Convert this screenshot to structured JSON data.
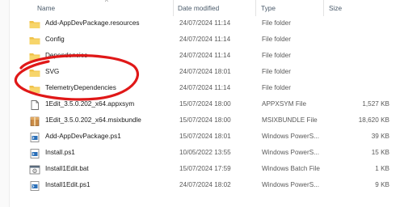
{
  "columns": {
    "name": "Name",
    "date": "Date modified",
    "type": "Type",
    "size": "Size"
  },
  "sort_indicator": "^",
  "files": [
    {
      "name": "Add-AppDevPackage.resources",
      "date": "24/07/2024 11:14",
      "type": "File folder",
      "size": "",
      "icon": "folder-icon"
    },
    {
      "name": "Config",
      "date": "24/07/2024 11:14",
      "type": "File folder",
      "size": "",
      "icon": "folder-icon"
    },
    {
      "name": "Dependencies",
      "date": "24/07/2024 11:14",
      "type": "File folder",
      "size": "",
      "icon": "folder-icon"
    },
    {
      "name": "SVG",
      "date": "24/07/2024 18:01",
      "type": "File folder",
      "size": "",
      "icon": "folder-icon"
    },
    {
      "name": "TelemetryDependencies",
      "date": "24/07/2024 11:14",
      "type": "File folder",
      "size": "",
      "icon": "folder-icon"
    },
    {
      "name": "1Edit_3.5.0.202_x64.appxsym",
      "date": "15/07/2024 18:00",
      "type": "APPXSYM File",
      "size": "1,527 KB",
      "icon": "blank-file-icon"
    },
    {
      "name": "1Edit_3.5.0.202_x64.msixbundle",
      "date": "15/07/2024 18:00",
      "type": "MSIXBUNDLE File",
      "size": "18,620 KB",
      "icon": "package-icon"
    },
    {
      "name": "Add-AppDevPackage.ps1",
      "date": "15/07/2024 18:01",
      "type": "Windows PowerS...",
      "size": "39 KB",
      "icon": "script-icon"
    },
    {
      "name": "Install.ps1",
      "date": "10/05/2022 13:55",
      "type": "Windows PowerS...",
      "size": "15 KB",
      "icon": "script-icon"
    },
    {
      "name": "Install1Edit.bat",
      "date": "15/07/2024 17:59",
      "type": "Windows Batch File",
      "size": "1 KB",
      "icon": "batch-file-icon"
    },
    {
      "name": "Install1Edit.ps1",
      "date": "24/07/2024 18:02",
      "type": "Windows PowerS...",
      "size": "9 KB",
      "icon": "script-icon"
    }
  ],
  "colors": {
    "folder": "#f0c24a",
    "annotation_circle": "#e01818",
    "header_text": "#4a5a6a"
  }
}
